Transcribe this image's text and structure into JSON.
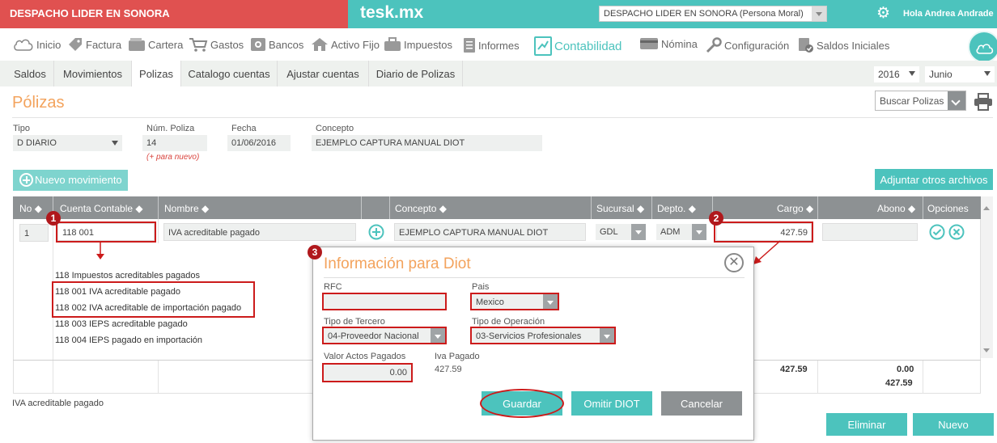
{
  "topbar": {
    "company": "DESPACHO LIDER EN SONORA",
    "brand": "tesk.mx",
    "company_select": "DESPACHO LIDER EN SONORA (Persona Moral)",
    "greeting": "Hola Andrea Andrade"
  },
  "mainnav": {
    "items": [
      {
        "label": "Inicio",
        "icon": "cloud-icon"
      },
      {
        "label": "Factura",
        "icon": "tag-icon"
      },
      {
        "label": "Cartera",
        "icon": "wallet-icon"
      },
      {
        "label": "Gastos",
        "icon": "cart-icon"
      },
      {
        "label": "Bancos",
        "icon": "safe-icon"
      },
      {
        "label": "Activo Fijo",
        "icon": "house-icon"
      },
      {
        "label": "Impuestos",
        "icon": "briefcase-icon"
      },
      {
        "label": "Informes",
        "icon": "document-icon"
      },
      {
        "label": "Contabilidad",
        "icon": "chart-icon"
      },
      {
        "label": "Nómina",
        "icon": "card-icon"
      },
      {
        "label": "Configuración",
        "icon": "wrench-icon"
      },
      {
        "label": "Saldos Iniciales",
        "icon": "check-document-icon"
      }
    ],
    "active": "Contabilidad"
  },
  "subnav": {
    "tabs": [
      "Saldos",
      "Movimientos",
      "Polizas",
      "Catalogo cuentas",
      "Ajustar cuentas",
      "Diario de Polizas"
    ],
    "active": "Polizas",
    "year": "2016",
    "month": "Junio"
  },
  "page": {
    "title": "Pólizas",
    "search_placeholder": "Buscar Polizas"
  },
  "form": {
    "tipo_label": "Tipo",
    "tipo_value": "D DIARIO",
    "num_label": "Núm. Poliza",
    "num_value": "14",
    "num_hint": "(+ para nuevo)",
    "fecha_label": "Fecha",
    "fecha_value": "01/06/2016",
    "concepto_label": "Concepto",
    "concepto_value": "EJEMPLO CAPTURA MANUAL DIOT"
  },
  "actions": {
    "new_movement": "Nuevo movimiento",
    "attach": "Adjuntar otros archivos",
    "delete": "Eliminar",
    "new": "Nuevo"
  },
  "table": {
    "headers": [
      "No",
      "Cuenta Contable",
      "Nombre",
      "Concepto",
      "Sucursal",
      "Depto.",
      "Cargo",
      "Abono",
      "Opciones"
    ],
    "row": {
      "no": "1",
      "cuenta": "118 001",
      "nombre": "IVA acreditable pagado",
      "concepto": "EJEMPLO CAPTURA MANUAL DIOT",
      "sucursal": "GDL",
      "depto": "ADM",
      "cargo": "427.59",
      "abono": ""
    },
    "suggestions": [
      "118 Impuestos acreditables pagados",
      "118 001 IVA acreditable pagado",
      "118 002 IVA acreditable de importación pagado",
      "118 003 IEPS acreditable pagado",
      "118 004 IEPS pagado en importación"
    ],
    "totals": {
      "cargo": "427.59",
      "abono": "0.00",
      "diff": "427.59"
    }
  },
  "footer_note": "IVA acreditable pagado",
  "markers": [
    "1",
    "2",
    "3"
  ],
  "modal": {
    "title": "Información para Diot",
    "rfc_label": "RFC",
    "rfc_value": "",
    "pais_label": "Pais",
    "pais_value": "Mexico",
    "tercero_label": "Tipo de Tercero",
    "tercero_value": "04-Proveedor Nacional",
    "operacion_label": "Tipo de Operación",
    "operacion_value": "03-Servicios Profesionales",
    "actos_label": "Valor Actos Pagados",
    "actos_value": "0.00",
    "iva_label": "Iva Pagado",
    "iva_value": "427.59",
    "save": "Guardar",
    "skip": "Omitir DIOT",
    "cancel": "Cancelar"
  },
  "colors": {
    "accent": "#4cc3bd",
    "company_red": "#e05150",
    "title_orange": "#f3a35d",
    "header_gray": "#8d9193",
    "annotation_red": "#cc1b1b"
  }
}
